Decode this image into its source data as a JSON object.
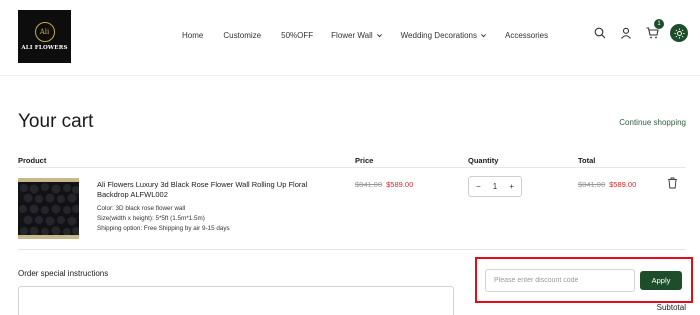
{
  "brand": {
    "logo_emblem": "Ali",
    "logo_text": "ALI FLOWERS",
    "accent_color": "#1e4d2b"
  },
  "nav": {
    "items": [
      {
        "label": "Home",
        "has_dropdown": false
      },
      {
        "label": "Customize",
        "has_dropdown": false
      },
      {
        "label": "50%OFF",
        "has_dropdown": false
      },
      {
        "label": "Flower Wall",
        "has_dropdown": true
      },
      {
        "label": "Wedding Decorations",
        "has_dropdown": true
      },
      {
        "label": "Accessories",
        "has_dropdown": false
      }
    ]
  },
  "header_icons": {
    "search": "search-icon",
    "account": "user-icon",
    "cart": "cart-icon",
    "cart_count": "1",
    "theme": "sun-icon"
  },
  "cart": {
    "title": "Your cart",
    "continue_label": "Continue shopping",
    "columns": [
      "Product",
      "Price",
      "Quantity",
      "Total"
    ],
    "items": [
      {
        "name": "Ali Flowers Luxury 3d Black Rose Flower Wall Rolling Up Floral Backdrop ALFWL002",
        "color": "Color: 3D black rose flower wall",
        "size": "Size(width x height): 5*5ft (1.5m*1.5m)",
        "shipping": "Shipping option: Free Shipping by air 9-15 days",
        "price_original": "$841.00",
        "price_sale": "$589.00",
        "quantity": "1",
        "qty_minus": "−",
        "qty_plus": "+",
        "total_original": "$841.00",
        "total_sale": "$589.00"
      }
    ]
  },
  "footer": {
    "instructions_label": "Order special instructions",
    "discount_placeholder": "Please enter discount code",
    "apply_label": "Apply",
    "subtotal_label": "Subtotal"
  }
}
